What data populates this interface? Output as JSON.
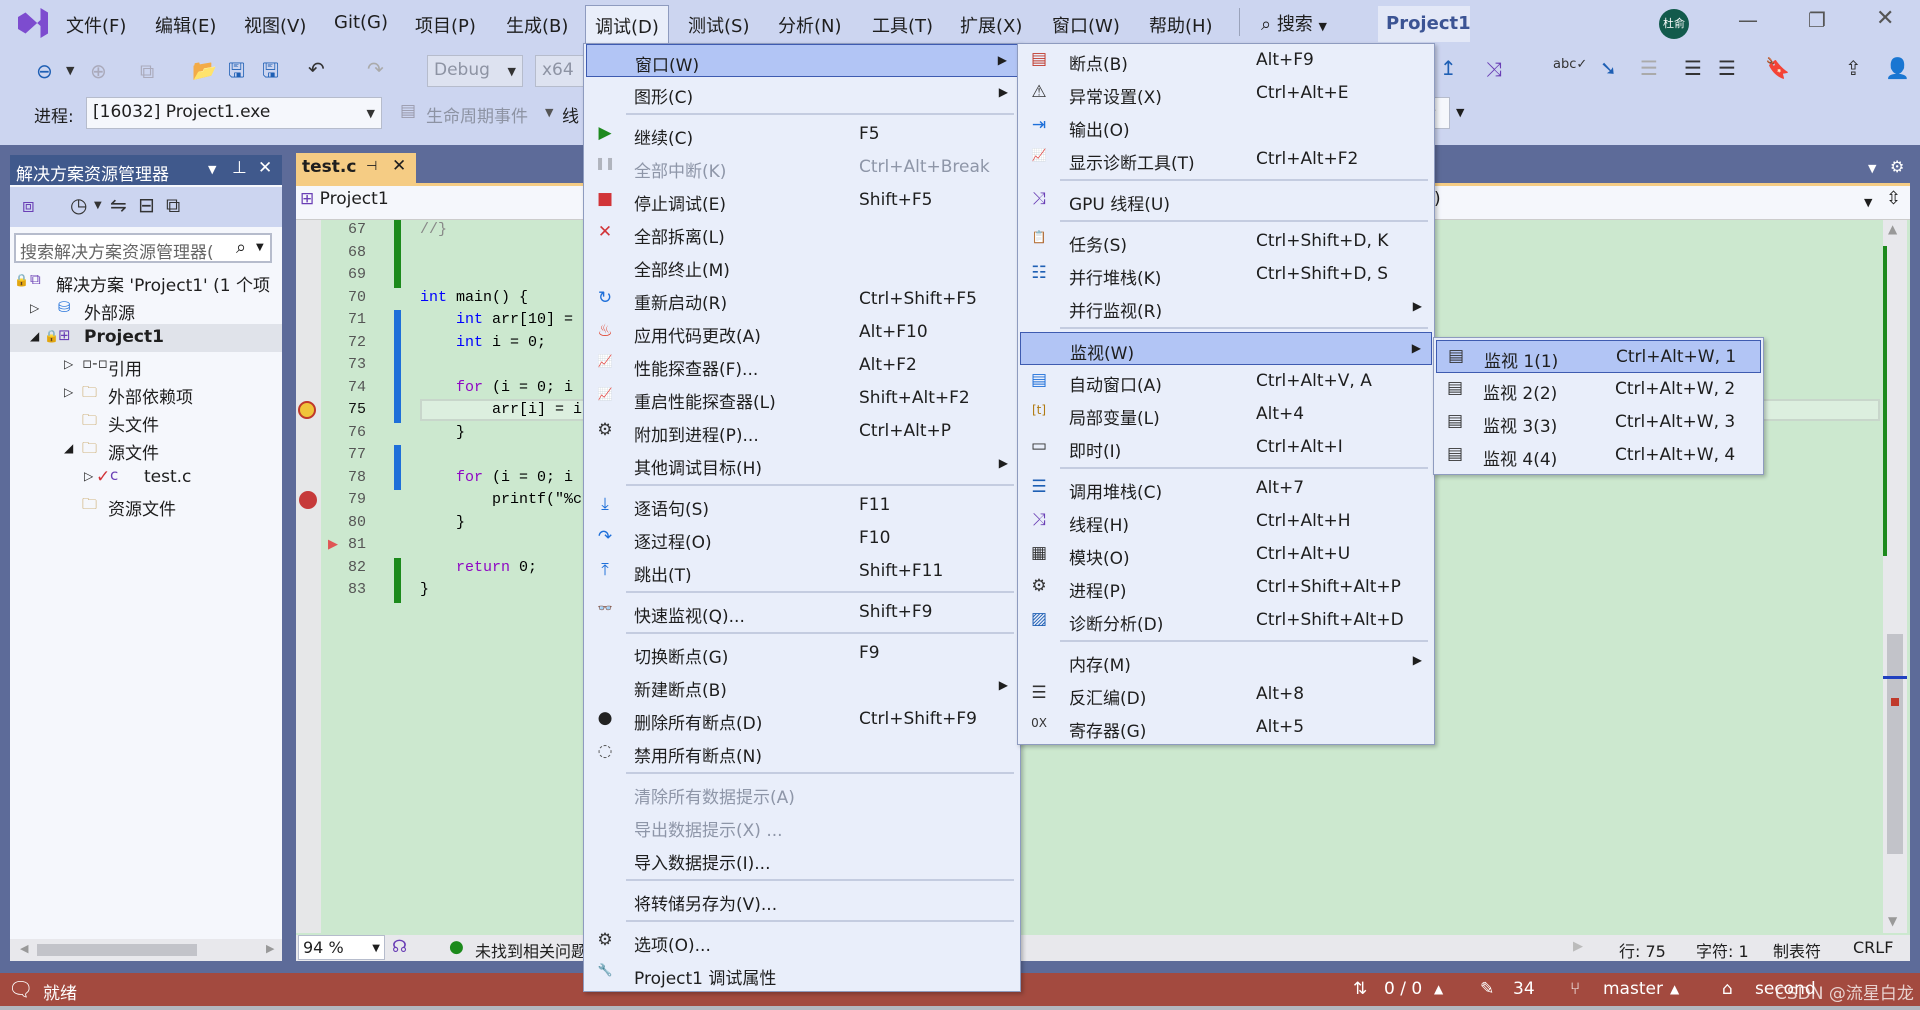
{
  "menubar": {
    "items": [
      "文件(F)",
      "编辑(E)",
      "视图(V)",
      "Git(G)",
      "项目(P)",
      "生成(B)",
      "调试(D)",
      "测试(S)",
      "分析(N)",
      "工具(T)",
      "扩展(X)",
      "窗口(W)",
      "帮助(H)"
    ],
    "active": "调试(D)",
    "search": "搜索",
    "solution_badge": "Project1",
    "avatar": "杜俞"
  },
  "toolbar": {
    "config": "Debug",
    "platform": "x64",
    "process_label": "进程:",
    "process": "[16032] Project1.exe",
    "lifecycle": "生命周期事件",
    "thread_label": "线"
  },
  "solution_explorer": {
    "title": "解决方案资源管理器",
    "search_placeholder": "搜索解决方案资源管理器(",
    "tree": [
      {
        "label": "解决方案 'Project1' (1 个项",
        "icon": "solution-icon",
        "level": 0,
        "expander": ""
      },
      {
        "label": "外部源",
        "icon": "external-source-icon",
        "level": 1,
        "expander": "▷"
      },
      {
        "label": "Project1",
        "icon": "project-icon",
        "level": 1,
        "expander": "◢",
        "selected": true,
        "bold": true
      },
      {
        "label": "引用",
        "icon": "reference-icon",
        "level": 2,
        "expander": "▷"
      },
      {
        "label": "外部依赖项",
        "icon": "folder-icon",
        "level": 2,
        "expander": "▷"
      },
      {
        "label": "头文件",
        "icon": "filter-folder-icon",
        "level": 2,
        "expander": ""
      },
      {
        "label": "源文件",
        "icon": "filter-folder-icon",
        "level": 2,
        "expander": "◢"
      },
      {
        "label": "test.c",
        "icon": "c-file-icon",
        "level": 3,
        "expander": "▷"
      },
      {
        "label": "资源文件",
        "icon": "filter-folder-icon",
        "level": 2,
        "expander": ""
      }
    ]
  },
  "editor": {
    "tab": "test.c",
    "nav_project": "Project1",
    "nav_right": ")",
    "zoom": "94 %",
    "issues": "未找到相关问题",
    "lines": [
      {
        "n": "67",
        "code": "//}"
      },
      {
        "n": "68",
        "code": ""
      },
      {
        "n": "69",
        "code": ""
      },
      {
        "n": "70",
        "code": "int main() {"
      },
      {
        "n": "71",
        "code": "    int arr[10] ="
      },
      {
        "n": "72",
        "code": "    int i = 0;"
      },
      {
        "n": "73",
        "code": ""
      },
      {
        "n": "74",
        "code": "    for (i = 0; i"
      },
      {
        "n": "75",
        "code": "        arr[i] = i"
      },
      {
        "n": "76",
        "code": "    }"
      },
      {
        "n": "77",
        "code": ""
      },
      {
        "n": "78",
        "code": "    for (i = 0; i"
      },
      {
        "n": "79",
        "code": "        printf(\"%c"
      },
      {
        "n": "80",
        "code": "    }"
      },
      {
        "n": "81",
        "code": ""
      },
      {
        "n": "82",
        "code": "    return 0;"
      },
      {
        "n": "83",
        "code": "}"
      }
    ],
    "current_line": "75",
    "breakpoint_line": "79",
    "position": {
      "line": "行: 75",
      "char": "字符: 1",
      "tabs": "制表符",
      "eol": "CRLF"
    }
  },
  "debug_menu": [
    {
      "label": "窗口(W)",
      "submenu": true,
      "highlighted": true
    },
    {
      "label": "图形(C)",
      "submenu": true
    },
    {
      "sep": true
    },
    {
      "label": "继续(C)",
      "shortcut": "F5",
      "icon": "continue-icon"
    },
    {
      "label": "全部中断(K)",
      "shortcut": "Ctrl+Alt+Break",
      "icon": "pause-icon",
      "disabled": true
    },
    {
      "label": "停止调试(E)",
      "shortcut": "Shift+F5",
      "icon": "stop-icon"
    },
    {
      "label": "全部拆离(L)",
      "icon": "detach-icon"
    },
    {
      "label": "全部终止(M)"
    },
    {
      "label": "重新启动(R)",
      "shortcut": "Ctrl+Shift+F5",
      "icon": "restart-icon"
    },
    {
      "label": "应用代码更改(A)",
      "shortcut": "Alt+F10",
      "icon": "hot-reload-icon"
    },
    {
      "label": "性能探查器(F)...",
      "shortcut": "Alt+F2",
      "icon": "profiler-icon"
    },
    {
      "label": "重启性能探查器(L)",
      "shortcut": "Shift+Alt+F2",
      "icon": "profiler-icon"
    },
    {
      "label": "附加到进程(P)...",
      "shortcut": "Ctrl+Alt+P",
      "icon": "attach-icon"
    },
    {
      "label": "其他调试目标(H)",
      "submenu": true
    },
    {
      "sep": true
    },
    {
      "label": "逐语句(S)",
      "shortcut": "F11",
      "icon": "step-into-icon"
    },
    {
      "label": "逐过程(O)",
      "shortcut": "F10",
      "icon": "step-over-icon"
    },
    {
      "label": "跳出(T)",
      "shortcut": "Shift+F11",
      "icon": "step-out-icon"
    },
    {
      "sep": true
    },
    {
      "label": "快速监视(Q)...",
      "shortcut": "Shift+F9",
      "icon": "quick-watch-icon"
    },
    {
      "sep": true
    },
    {
      "label": "切换断点(G)",
      "shortcut": "F9"
    },
    {
      "label": "新建断点(B)",
      "submenu": true
    },
    {
      "label": "删除所有断点(D)",
      "shortcut": "Ctrl+Shift+F9",
      "icon": "delete-breakpoints-icon"
    },
    {
      "label": "禁用所有断点(N)",
      "icon": "disable-breakpoints-icon"
    },
    {
      "sep": true
    },
    {
      "label": "清除所有数据提示(A)",
      "disabled": true
    },
    {
      "label": "导出数据提示(X) ...",
      "disabled": true
    },
    {
      "label": "导入数据提示(I)..."
    },
    {
      "sep": true
    },
    {
      "label": "将转储另存为(V)..."
    },
    {
      "sep": true
    },
    {
      "label": "选项(O)...",
      "icon": "gear-icon"
    },
    {
      "label": "Project1 调试属性",
      "icon": "wrench-icon"
    }
  ],
  "window_menu": [
    {
      "label": "断点(B)",
      "shortcut": "Alt+F9",
      "icon": "breakpoints-window-icon"
    },
    {
      "label": "异常设置(X)",
      "shortcut": "Ctrl+Alt+E",
      "icon": "exception-settings-icon"
    },
    {
      "label": "输出(O)",
      "icon": "output-icon"
    },
    {
      "label": "显示诊断工具(T)",
      "shortcut": "Ctrl+Alt+F2",
      "icon": "diagnostics-icon"
    },
    {
      "sep": true
    },
    {
      "label": "GPU 线程(U)",
      "icon": "gpu-threads-icon"
    },
    {
      "sep": true
    },
    {
      "label": "任务(S)",
      "shortcut": "Ctrl+Shift+D, K",
      "icon": "tasks-icon"
    },
    {
      "label": "并行堆栈(K)",
      "shortcut": "Ctrl+Shift+D, S",
      "icon": "parallel-stacks-icon"
    },
    {
      "label": "并行监视(R)",
      "submenu": true
    },
    {
      "sep": true
    },
    {
      "label": "监视(W)",
      "submenu": true,
      "highlighted": true
    },
    {
      "label": "自动窗口(A)",
      "shortcut": "Ctrl+Alt+V, A",
      "icon": "autos-icon"
    },
    {
      "label": "局部变量(L)",
      "shortcut": "Alt+4",
      "icon": "locals-icon"
    },
    {
      "label": "即时(I)",
      "shortcut": "Ctrl+Alt+I",
      "icon": "immediate-icon"
    },
    {
      "sep": true
    },
    {
      "label": "调用堆栈(C)",
      "shortcut": "Alt+7",
      "icon": "call-stack-icon"
    },
    {
      "label": "线程(H)",
      "shortcut": "Ctrl+Alt+H",
      "icon": "threads-icon"
    },
    {
      "label": "模块(O)",
      "shortcut": "Ctrl+Alt+U",
      "icon": "modules-icon"
    },
    {
      "label": "进程(P)",
      "shortcut": "Ctrl+Shift+Alt+P",
      "icon": "processes-icon"
    },
    {
      "label": "诊断分析(D)",
      "shortcut": "Ctrl+Shift+Alt+D",
      "icon": "diagnostic-analysis-icon"
    },
    {
      "sep": true
    },
    {
      "label": "内存(M)",
      "submenu": true
    },
    {
      "label": "反汇编(D)",
      "shortcut": "Alt+8",
      "icon": "disassembly-icon"
    },
    {
      "label": "寄存器(G)",
      "shortcut": "Alt+5",
      "icon": "registers-icon"
    }
  ],
  "watch_menu": [
    {
      "label": "监视 1(1)",
      "shortcut": "Ctrl+Alt+W, 1",
      "icon": "watch-icon",
      "highlighted": true
    },
    {
      "label": "监视 2(2)",
      "shortcut": "Ctrl+Alt+W, 2",
      "icon": "watch-icon"
    },
    {
      "label": "监视 3(3)",
      "shortcut": "Ctrl+Alt+W, 3",
      "icon": "watch-icon"
    },
    {
      "label": "监视 4(4)",
      "shortcut": "Ctrl+Alt+W, 4",
      "icon": "watch-icon"
    }
  ],
  "statusbar": {
    "ready": "就绪",
    "sync": "0 / 0",
    "edits": "34",
    "branch": "master",
    "repo": "second",
    "watermark": "CSDN @流星白龙"
  },
  "colors": {
    "statusbar": "#a34a3f",
    "editor_bg": "#cce8cf",
    "menu_highlight": "#b2c5f5",
    "tab_active": "#f5cc84"
  }
}
